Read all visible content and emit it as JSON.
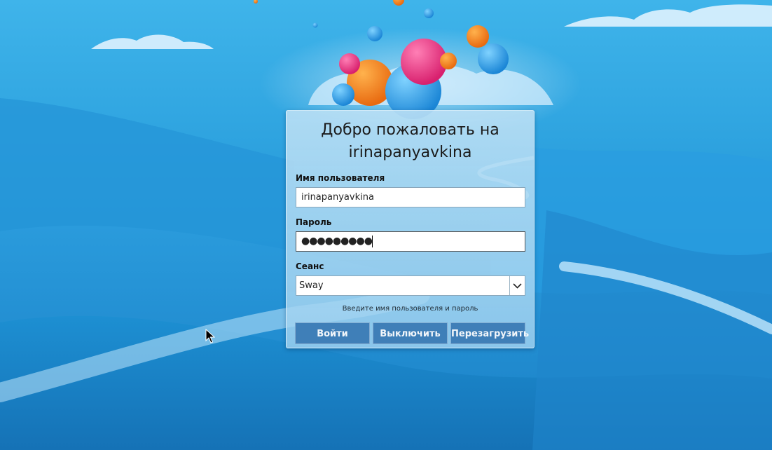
{
  "greeter": {
    "title_line1": "Добро пожаловать на",
    "title_line2": "irinapanyavkina",
    "username_label": "Имя пользователя",
    "username_value": "irinapanyavkina",
    "password_label": "Пароль",
    "password_mask": "●●●●●●●●●",
    "session_label": "Сеанс",
    "session_value": "Sway",
    "hint": "Введите имя пользователя и пароль",
    "buttons": {
      "login": "Войти",
      "shutdown": "Выключить",
      "reboot": "Перезагрузить"
    }
  },
  "icons": {
    "session_dropdown": "chevron-down-icon",
    "cursor": "mouse-pointer-icon"
  },
  "colors": {
    "button_bg": "#3f7fb8",
    "sky_top": "#3fb4ea",
    "sky_bottom": "#1a7cc4"
  }
}
